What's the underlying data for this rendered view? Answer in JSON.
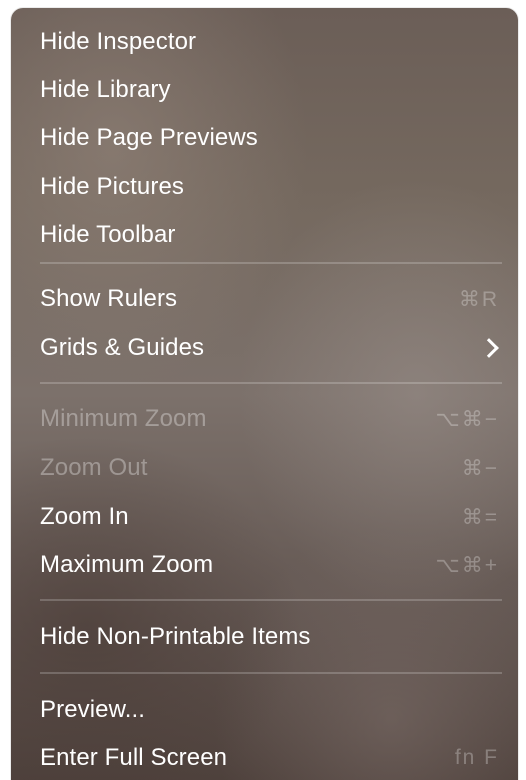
{
  "menu": {
    "group1": [
      {
        "label": "Hide Inspector"
      },
      {
        "label": "Hide Library"
      },
      {
        "label": "Hide Page Previews"
      },
      {
        "label": "Hide Pictures"
      },
      {
        "label": "Hide Toolbar"
      }
    ],
    "group2": [
      {
        "label": "Show Rulers",
        "shortcut": "⌘R"
      },
      {
        "label": "Grids & Guides",
        "submenu_icon": "chevron-right-icon"
      }
    ],
    "group3": [
      {
        "label": "Minimum Zoom",
        "shortcut": "⌥⌘−",
        "enabled": false
      },
      {
        "label": "Zoom Out",
        "shortcut": "⌘−",
        "enabled": false
      },
      {
        "label": "Zoom In",
        "shortcut": "⌘=",
        "enabled": true
      },
      {
        "label": "Maximum Zoom",
        "shortcut": "⌥⌘+",
        "enabled": true
      }
    ],
    "group4": [
      {
        "label": "Hide Non-Printable Items"
      }
    ],
    "group5": [
      {
        "label": "Preview..."
      },
      {
        "label": "Enter Full Screen",
        "shortcut": "fn F"
      }
    ]
  },
  "colors": {
    "text": "#ffffff",
    "disabled_text": "rgba(255,255,255,0.33)",
    "shortcut_text": "rgba(255,255,255,0.28)"
  }
}
